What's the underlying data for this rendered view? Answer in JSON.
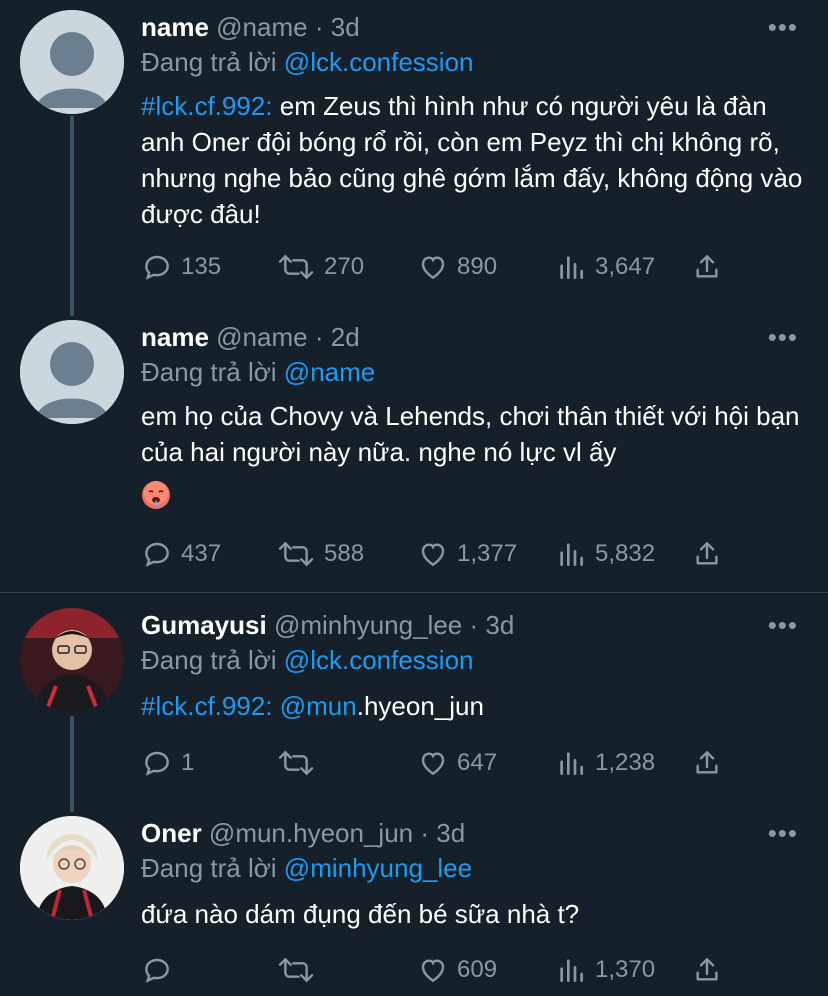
{
  "tweets": [
    {
      "name": "name",
      "handle": "@name",
      "time": "3d",
      "replying_prefix": "Đang trả lời",
      "replying_to": "@lck.confession",
      "tag": "#lck.cf.992:",
      "text": " em Zeus thì hình như có người yêu là đàn anh Oner đội bóng rổ rồi, còn em Peyz thì chị không rõ, nhưng nghe bảo cũng ghê gớm lắm đấy, không động vào được đâu!",
      "replies": "135",
      "retweets": "270",
      "likes": "890",
      "views": "3,647"
    },
    {
      "name": "name",
      "handle": "@name",
      "time": "2d",
      "replying_prefix": "Đang trả lời",
      "replying_to": "@name",
      "text": "em họ của Chovy và Lehends, chơi thân thiết với hội bạn của hai người này nữa. nghe nó lực vl ấy",
      "emoji": "hot-face-emoji",
      "replies": "437",
      "retweets": "588",
      "likes": "1,377",
      "views": "5,832"
    },
    {
      "name": "Gumayusi",
      "handle": "@minhyung_lee",
      "time": "3d",
      "replying_prefix": "Đang trả lời",
      "replying_to": "@lck.confession",
      "tag": "#lck.cf.992:",
      "mention_part": "@mun",
      "text_rest": ".hyeon_jun",
      "replies": "1",
      "retweets": "",
      "likes": "647",
      "views": "1,238"
    },
    {
      "name": "Oner",
      "handle": "@mun.hyeon_jun",
      "time": "3d",
      "replying_prefix": "Đang trả lời",
      "replying_to": "@minhyung_lee",
      "text": "đứa nào dám đụng đến bé sữa nhà t?",
      "replies": "",
      "retweets": "",
      "likes": "609",
      "views": "1,370"
    }
  ],
  "separator": "·",
  "more_label": "•••",
  "colors": {
    "background": "#15202b",
    "accent": "#1d9bf0",
    "muted": "#8899a6",
    "divider": "#38444d"
  }
}
